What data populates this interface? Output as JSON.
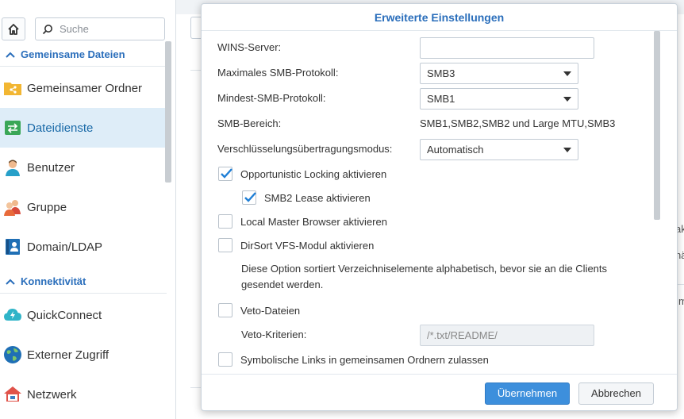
{
  "search": {
    "placeholder": "Suche"
  },
  "sidebar": {
    "sections": [
      {
        "label": "Gemeinsame Dateien"
      },
      {
        "label": "Konnektivität"
      }
    ],
    "items": [
      {
        "label": "Gemeinsamer Ordner",
        "icon": "shared-folder-icon",
        "active": false
      },
      {
        "label": "Dateidienste",
        "icon": "file-services-icon",
        "active": true
      },
      {
        "label": "Benutzer",
        "icon": "user-icon",
        "active": false
      },
      {
        "label": "Gruppe",
        "icon": "group-icon",
        "active": false
      },
      {
        "label": "Domain/LDAP",
        "icon": "domain-ldap-icon",
        "active": false
      },
      {
        "label": "QuickConnect",
        "icon": "quickconnect-icon",
        "active": false
      },
      {
        "label": "Externer Zugriff",
        "icon": "globe-icon",
        "active": false
      },
      {
        "label": "Netzwerk",
        "icon": "network-icon",
        "active": false
      }
    ]
  },
  "dialog": {
    "title": "Erweiterte Einstellungen",
    "wins_label": "WINS-Server:",
    "wins_value": "",
    "max_smb_label": "Maximales SMB-Protokoll:",
    "max_smb_value": "SMB3",
    "min_smb_label": "Mindest-SMB-Protokoll:",
    "min_smb_value": "SMB1",
    "smb_range_label": "SMB-Bereich:",
    "smb_range_value": "SMB1,SMB2,SMB2 und Large MTU,SMB3",
    "encryption_label": "Verschlüsselungsübertragungsmodus:",
    "encryption_value": "Automatisch",
    "oplocks_label": "Opportunistic Locking aktivieren",
    "oplocks_checked": true,
    "smb2lease_label": "SMB2 Lease aktivieren",
    "smb2lease_checked": true,
    "lmb_label": "Local Master Browser aktivieren",
    "lmb_checked": false,
    "dirsort_label": "DirSort VFS-Modul aktivieren",
    "dirsort_checked": false,
    "dirsort_desc": "Diese Option sortiert Verzeichniselemente alphabetisch, bevor sie an die Clients gesendet werden.",
    "veto_label": "Veto-Dateien",
    "veto_checked": false,
    "veto_criteria_label": "Veto-Kriterien:",
    "veto_criteria_placeholder": "/*.txt/README/",
    "symlinks_label": "Symbolische Links in gemeinsamen Ordnern zulassen",
    "symlinks_checked": false,
    "apply_label": "Übernehmen",
    "cancel_label": "Abbrechen"
  },
  "background": {
    "edge_text_1": "ak",
    "edge_text_2": "nä",
    "edge_text_3": "m"
  },
  "colors": {
    "accent": "#2a6ebb",
    "primary_button": "#3d8fdc",
    "active_nav_bg": "#deedf8",
    "checkbox_check": "#1f7fd6"
  }
}
